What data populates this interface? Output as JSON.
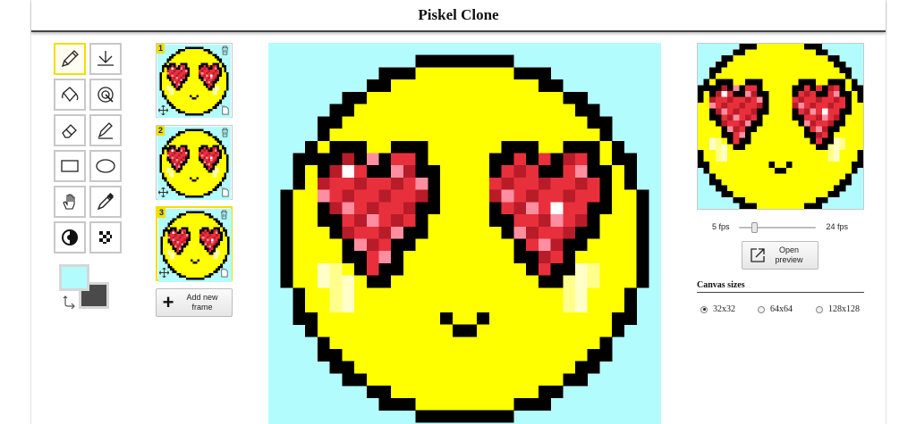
{
  "app": {
    "title": "Piskel Clone"
  },
  "tools": [
    {
      "name": "pen-tool",
      "icon": "pencil-icon",
      "selected": true
    },
    {
      "name": "vertical-mirror-pen-tool",
      "icon": "mirror-pen-icon",
      "selected": false
    },
    {
      "name": "paint-bucket-tool",
      "icon": "paint-bucket-icon",
      "selected": false
    },
    {
      "name": "paint-same-pixels-tool",
      "icon": "same-pixels-icon",
      "selected": false
    },
    {
      "name": "eraser-tool",
      "icon": "eraser-icon",
      "selected": false
    },
    {
      "name": "stroke-tool",
      "icon": "stroke-icon",
      "selected": false
    },
    {
      "name": "rectangle-tool",
      "icon": "rectangle-icon",
      "selected": false
    },
    {
      "name": "circle-tool",
      "icon": "circle-icon",
      "selected": false
    },
    {
      "name": "move-tool",
      "icon": "hand-icon",
      "selected": false
    },
    {
      "name": "color-picker-tool",
      "icon": "eyedropper-icon",
      "selected": false
    },
    {
      "name": "lighten-tool",
      "icon": "lighten-icon",
      "selected": false
    },
    {
      "name": "dithering-tool",
      "icon": "checker-icon",
      "selected": false
    }
  ],
  "colors": {
    "primary": "#b3fcfe",
    "secondary": "#4a4a4a"
  },
  "palette": {
    "background": "#b3fcfe",
    "black": "#000000",
    "yellow": "#ffff00",
    "red": "#e8303c",
    "dark_red": "#b81c28",
    "pink": "#ff8fa0",
    "white": "#ffffff",
    "blush_light": "#ffffc8",
    "blush_mid": "#ffff8c",
    "accent": "#f0e000"
  },
  "frames": [
    {
      "number": "1",
      "selected": false
    },
    {
      "number": "2",
      "selected": false
    },
    {
      "number": "3",
      "selected": true
    }
  ],
  "add_frame": {
    "label_line1": "Add new",
    "label_line2": "frame",
    "icon": "plus-icon"
  },
  "preview": {
    "fps_min_label": "5 fps",
    "fps_max_label": "24 fps",
    "fps_min": 5,
    "fps_max": 24,
    "fps_value": 6
  },
  "open_preview": {
    "label_line1": "Open",
    "label_line2": "preview",
    "icon": "external-link-icon"
  },
  "canvas_sizes": {
    "title": "Canvas sizes",
    "options": [
      {
        "label": "32x32",
        "selected": true
      },
      {
        "label": "64x64",
        "selected": false
      },
      {
        "label": "128x128",
        "selected": false
      }
    ]
  }
}
